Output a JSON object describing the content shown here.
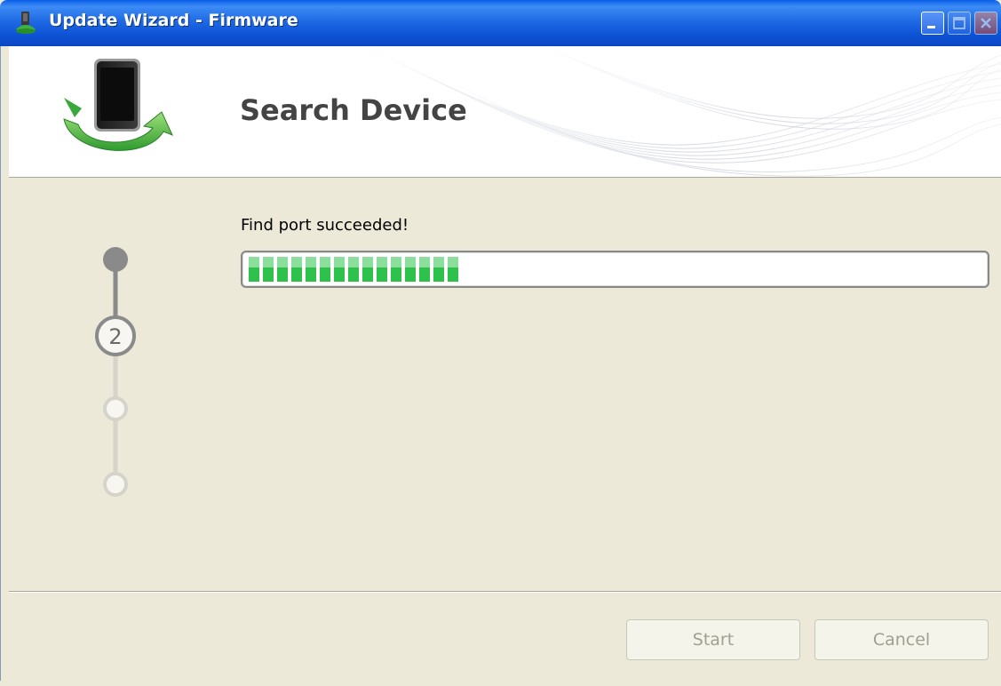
{
  "window": {
    "title": "Update Wizard - Firmware",
    "title_icon": "usb-plug-icon",
    "controls": [
      "minimize-icon",
      "maximize-icon",
      "close-icon"
    ]
  },
  "header": {
    "icon": "phone-sync-icon",
    "page_title": "Search Device"
  },
  "steps": {
    "current": 2,
    "total": 4,
    "current_label": "2"
  },
  "content": {
    "status": "Find port succeeded!",
    "progress_fraction": 0.29
  },
  "footer": {
    "start_label": "Start",
    "cancel_label": "Cancel"
  },
  "colors": {
    "titlebar": "#0e53d6",
    "progress": "#2ec24d",
    "dialog_bg": "#ece9d8"
  }
}
